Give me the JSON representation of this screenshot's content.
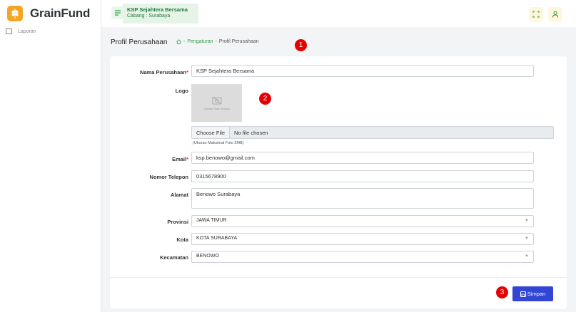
{
  "brand": {
    "name": "GrainFund",
    "accent": "#f5a524"
  },
  "sidebar": {
    "items": [
      {
        "label": "Laporan",
        "icon": "report-icon"
      }
    ]
  },
  "header": {
    "org_name": "KSP Sejahtera Bersama",
    "branch": "Cabang : Surabaya",
    "menu_icon": "hamburger-icon",
    "fullscreen_icon": "fullscreen-icon",
    "user_icon": "user-icon"
  },
  "page": {
    "title": "Profil Perusahaan",
    "breadcrumb": {
      "sep": "-",
      "parent": "Pengaturan",
      "current": "Profil Perusahaan"
    }
  },
  "form": {
    "nama": {
      "label": "Nama Perusahaan",
      "required": "*",
      "value": "KSP Sejahtera Bersama"
    },
    "logo": {
      "label": "Logo",
      "caption": "Gambar Tidak Tersedia"
    },
    "file": {
      "button": "Choose File",
      "status": "No file chosen",
      "hint": "(Ukuran Maksimal Foto 2MB)"
    },
    "email": {
      "label": "Email",
      "required": "*",
      "value": "ksp.benowo@gmail.com"
    },
    "telepon": {
      "label": "Nomor Telepon",
      "value": "0315678900"
    },
    "alamat": {
      "label": "Alamat",
      "value": "Benowo Surabaya"
    },
    "provinsi": {
      "label": "Provinsi",
      "value": "JAWA TIMUR"
    },
    "kota": {
      "label": "Kota",
      "value": "KOTA SURABAYA"
    },
    "kecamatan": {
      "label": "Kecamatan",
      "value": "BENOWO"
    }
  },
  "actions": {
    "save": "Simpan",
    "save_color": "#3245d4"
  },
  "markers": [
    "1",
    "2",
    "3"
  ]
}
